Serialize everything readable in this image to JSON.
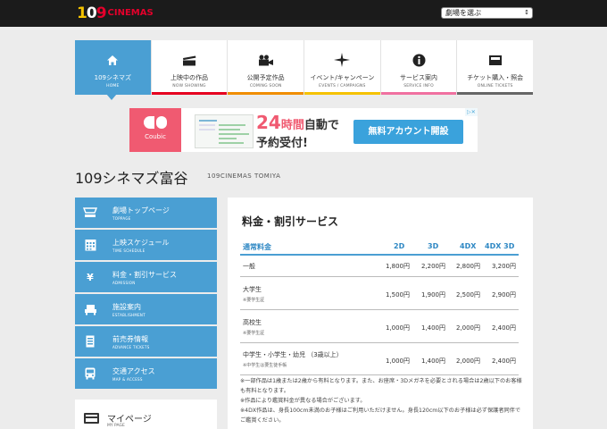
{
  "header": {
    "logo_nums": [
      "1",
      "0",
      "9"
    ],
    "logo_word": "CINEMAS",
    "theater_select": "劇場を選ぶ"
  },
  "nav": [
    {
      "label": "109シネマズ",
      "sub": "HOME",
      "icon": "home-icon",
      "active": true,
      "color": "#4a9fd3"
    },
    {
      "label": "上映中の作品",
      "sub": "NOW SHOWING",
      "icon": "clapperboard-icon",
      "active": false,
      "color": "#e6001f"
    },
    {
      "label": "公開予定作品",
      "sub": "COMING SOON",
      "icon": "movie-camera-icon",
      "active": false,
      "color": "#f08d00"
    },
    {
      "label": "イベント/キャンペーン",
      "sub": "EVENTS / CAMPAIGNS",
      "icon": "sparkle-icon",
      "active": false,
      "color": "#f5c200"
    },
    {
      "label": "サービス案内",
      "sub": "SERVICE INFO",
      "icon": "info-icon",
      "active": false,
      "color": "#f070a0"
    },
    {
      "label": "チケット購入・照会",
      "sub": "ONLINE TICKETS",
      "icon": "ticket-icon",
      "active": false,
      "color": "#666666"
    }
  ],
  "ad": {
    "brand": "Coubic",
    "headline_num": "24",
    "headline_unit": "時間",
    "headline_rest": "自動で",
    "subline": "予約受付!",
    "cta": "無料アカウント開設"
  },
  "page": {
    "title": "109シネマズ富谷",
    "title_en": "109CINEMAS TOMIYA"
  },
  "sidebar": [
    {
      "label": "劇場トップページ",
      "sub": "TOPPAGE",
      "icon": "theater-icon"
    },
    {
      "label": "上映スケジュール",
      "sub": "TIME SCHEDULE",
      "icon": "calendar-icon"
    },
    {
      "label": "料金・割引サービス",
      "sub": "ADMISSION",
      "icon": "yen-icon"
    },
    {
      "label": "施設案内",
      "sub": "ESTABLISHMENT",
      "icon": "seat-icon"
    },
    {
      "label": "前売券情報",
      "sub": "ADVANCE TICKETS",
      "icon": "ticket-stub-icon"
    },
    {
      "label": "交通アクセス",
      "sub": "MAP & ACCESS",
      "icon": "bus-icon"
    }
  ],
  "mypage": {
    "label": "マイページ",
    "sub": "MY PAGE"
  },
  "main": {
    "title": "料金・割引サービス",
    "table": {
      "headers": [
        "通常料金",
        "2D",
        "3D",
        "4DX",
        "4DX 3D"
      ],
      "rows": [
        {
          "label": "一般",
          "note": "",
          "values": [
            "1,800円",
            "2,200円",
            "2,800円",
            "3,200円"
          ]
        },
        {
          "label": "大学生",
          "note": "※要学生証",
          "values": [
            "1,500円",
            "1,900円",
            "2,500円",
            "2,900円"
          ]
        },
        {
          "label": "高校生",
          "note": "※要学生証",
          "values": [
            "1,000円",
            "1,400円",
            "2,000円",
            "2,400円"
          ]
        },
        {
          "label": "中学生・小学生・幼児 （3歳以上）",
          "note": "※中学生は要生徒手帳",
          "values": [
            "1,000円",
            "1,400円",
            "2,000円",
            "2,400円"
          ]
        }
      ]
    },
    "notes": [
      "※一部作品は1歳または2歳から有料となります。また、お座席・3Dメガネを必要とされる場合は2歳以下のお客様も有料となります。",
      "※作品により鑑賞料金が異なる場合がございます。",
      "※4DX作品は、身長100cm未満のお子様はご利用いただけません。身長120cm以下のお子様は必ず保護者同伴でご鑑賞ください。"
    ]
  }
}
